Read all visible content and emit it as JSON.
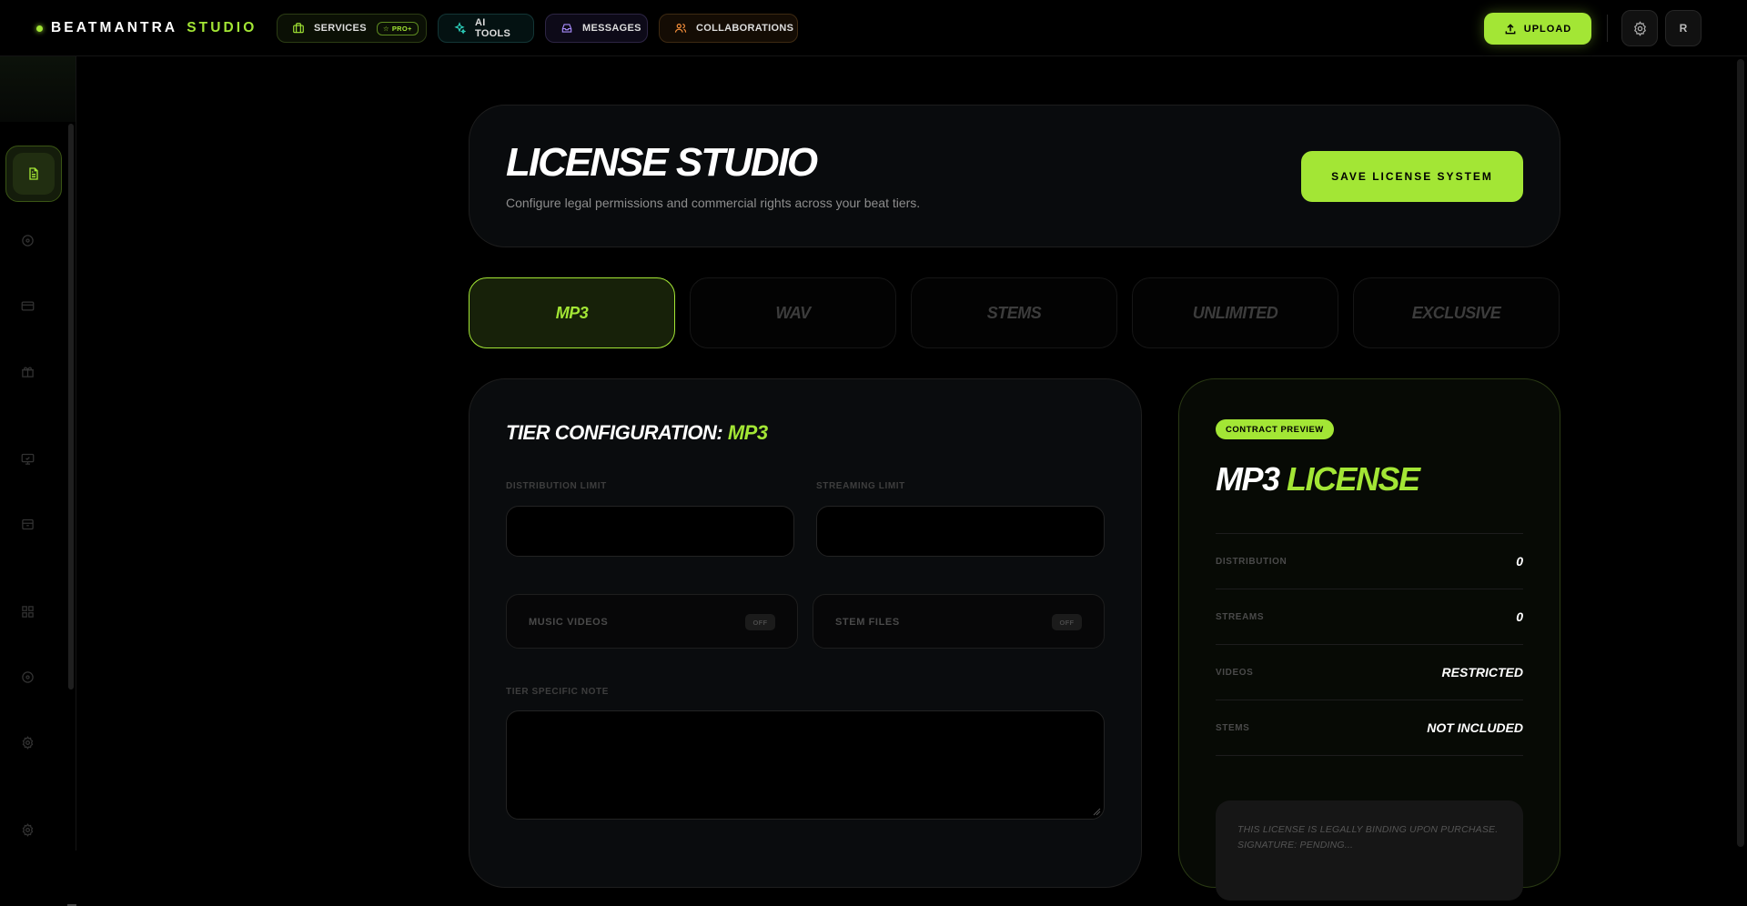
{
  "brand": {
    "word1": "BEATMANTRA",
    "word2": "STUDIO",
    "accent": "#a3e635"
  },
  "nav": {
    "services": {
      "label": "SERVICES",
      "icon": "briefcase-icon",
      "badge": "PRO+"
    },
    "ai_tools": {
      "label": "AI TOOLS",
      "icon": "sparkles-icon"
    },
    "messages": {
      "label": "MESSAGES",
      "icon": "inbox-icon"
    },
    "collaborations": {
      "label": "COLLABORATIONS",
      "icon": "users-icon"
    }
  },
  "toolbar": {
    "upload_label": "UPLOAD",
    "avatar_initial": "R"
  },
  "sidebar": {
    "items": [
      {
        "icon": "document-icon",
        "active": true
      },
      {
        "icon": "disc-icon"
      },
      {
        "icon": "credit-card-icon"
      },
      {
        "icon": "gift-icon"
      },
      {
        "icon": "monitor-icon"
      },
      {
        "icon": "archive-icon"
      },
      {
        "icon": "grid-icon"
      },
      {
        "icon": "disc-icon"
      },
      {
        "icon": "gear-icon"
      },
      {
        "icon": "gear-icon"
      }
    ]
  },
  "header": {
    "title": "LICENSE STUDIO",
    "subtitle": "Configure legal permissions and commercial rights across your beat tiers.",
    "save_label": "SAVE LICENSE SYSTEM"
  },
  "tabs": [
    {
      "label": "MP3",
      "active": true
    },
    {
      "label": "WAV"
    },
    {
      "label": "STEMS"
    },
    {
      "label": "UNLIMITED"
    },
    {
      "label": "EXCLUSIVE"
    }
  ],
  "config": {
    "title_prefix": "TIER CONFIGURATION:",
    "title_tier": "MP3",
    "distribution_label": "DISTRIBUTION LIMIT",
    "distribution_value": "",
    "streaming_label": "STREAMING LIMIT",
    "streaming_value": "",
    "music_videos_label": "MUSIC VIDEOS",
    "music_videos_state": "OFF",
    "stem_files_label": "STEM FILES",
    "stem_files_state": "OFF",
    "note_label": "TIER SPECIFIC NOTE",
    "note_value": ""
  },
  "preview": {
    "badge": "CONTRACT PREVIEW",
    "title_tier": "MP3",
    "title_word": "LICENSE",
    "rows": [
      {
        "label": "DISTRIBUTION",
        "value": "0"
      },
      {
        "label": "STREAMS",
        "value": "0"
      },
      {
        "label": "VIDEOS",
        "value": "RESTRICTED"
      },
      {
        "label": "STEMS",
        "value": "NOT INCLUDED"
      }
    ],
    "legal_line1": "THIS LICENSE IS LEGALLY BINDING UPON PURCHASE.",
    "legal_line2": "SIGNATURE: PENDING..."
  }
}
